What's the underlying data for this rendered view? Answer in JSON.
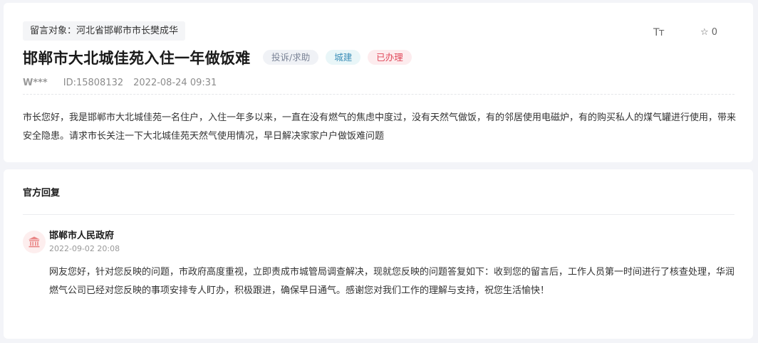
{
  "complaint": {
    "recipient": "留言对象：河北省邯郸市市长樊成华",
    "title": "邯郸市大北城佳苑入住一年做饭难",
    "tags": {
      "type": "投诉/求助",
      "department": "城建",
      "status": "已办理"
    },
    "toolbar": {
      "font_size_icon": "font-size-icon",
      "font_size_glyph": "Tт",
      "favorite_icon": "star-icon",
      "favorite_glyph": "☆",
      "favorite_count": "0"
    },
    "user": "W***",
    "id": "ID:15808132",
    "time": "2022-08-24 09:31",
    "content": "市长您好，我是邯郸市大北城佳苑一名住户，入住一年多以来，一直在没有燃气的焦虑中度过，没有天然气做饭，有的邻居使用电磁炉，有的购买私人的煤气罐进行使用，带来安全隐患。请求市长关注一下大北城佳苑天然气使用情况，早日解决家家户户做饭难问题"
  },
  "reply": {
    "heading": "官方回复",
    "avatar_icon": "government-building-icon",
    "org_name": "邯郸市人民政府",
    "time": "2022-09-02 20:08",
    "content": "网友您好，针对您反映的问题，市政府高度重视，立即责成市城管局调查解决，现就您反映的问题答复如下：收到您的留言后，工作人员第一时间进行了核查处理，华润燃气公司已经对您反映的事项安排专人盯办，积极跟进，确保早日通气。感谢您对我们工作的理解与支持，祝您生活愉快！"
  },
  "colors": {
    "status_tag": "#e0485a",
    "department_tag": "#3d8fb8",
    "avatar_icon": "#e98585"
  }
}
